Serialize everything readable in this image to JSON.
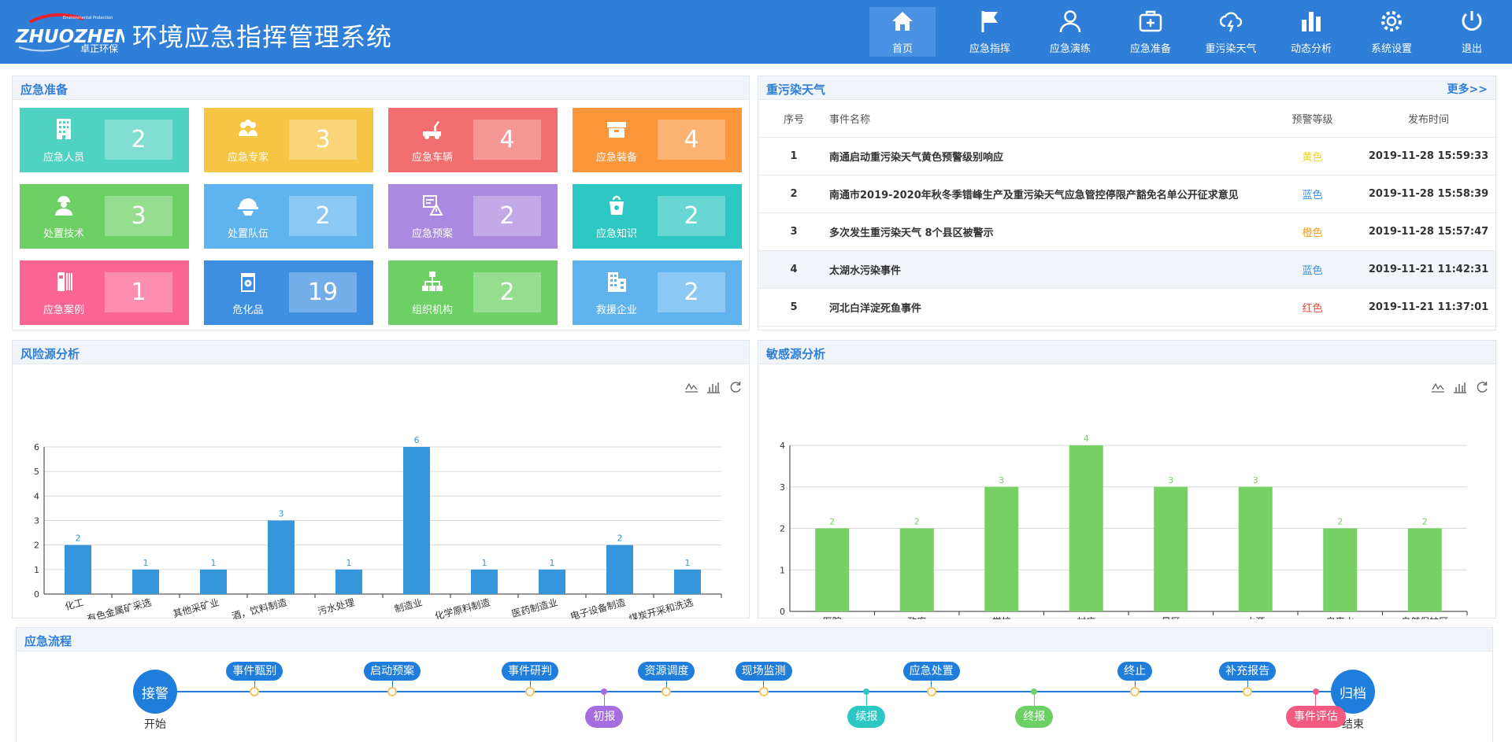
{
  "header": {
    "brand_en": "ZHUOZHENG",
    "brand_tag": "Environmental Protection",
    "brand_cn": "卓正环保",
    "title": "环境应急指挥管理系统",
    "nav": [
      {
        "label": "首页",
        "icon": "home-icon",
        "active": true
      },
      {
        "label": "应急指挥",
        "icon": "flag-icon"
      },
      {
        "label": "应急演练",
        "icon": "user-icon"
      },
      {
        "label": "应急准备",
        "icon": "medkit-icon"
      },
      {
        "label": "重污染天气",
        "icon": "storm-cloud-icon"
      },
      {
        "label": "动态分析",
        "icon": "bar-chart-icon"
      },
      {
        "label": "系统设置",
        "icon": "gear-icon"
      },
      {
        "label": "退出",
        "icon": "power-icon"
      }
    ]
  },
  "prep": {
    "title": "应急准备",
    "tiles": [
      {
        "label": "应急人员",
        "count": "2",
        "color": "#4fd2c1",
        "icon": "building-icon"
      },
      {
        "label": "应急专家",
        "count": "3",
        "color": "#f7c544",
        "icon": "experts-icon"
      },
      {
        "label": "应急车辆",
        "count": "4",
        "color": "#f36f6f",
        "icon": "tow-truck-icon"
      },
      {
        "label": "应急装备",
        "count": "4",
        "color": "#fb963b",
        "icon": "equipment-box-icon"
      },
      {
        "label": "处置技术",
        "count": "3",
        "color": "#6cd065",
        "icon": "worker-icon"
      },
      {
        "label": "处置队伍",
        "count": "2",
        "color": "#5fb3ef",
        "icon": "helmet-icon"
      },
      {
        "label": "应急预案",
        "count": "2",
        "color": "#ab89e0",
        "icon": "plan-doc-icon"
      },
      {
        "label": "应急知识",
        "count": "2",
        "color": "#2ec8c4",
        "icon": "knowledge-bag-icon"
      },
      {
        "label": "应急案例",
        "count": "1",
        "color": "#fb6593",
        "icon": "case-file-icon"
      },
      {
        "label": "危化品",
        "count": "19",
        "color": "#3e8fe2",
        "icon": "hazmat-barrel-icon"
      },
      {
        "label": "组织机构",
        "count": "2",
        "color": "#6cd065",
        "icon": "org-chart-icon"
      },
      {
        "label": "救援企业",
        "count": "2",
        "color": "#5fb3ef",
        "icon": "enterprise-icon"
      }
    ]
  },
  "weather": {
    "title": "重污染天气",
    "more": "更多>>",
    "columns": [
      "序号",
      "事件名称",
      "预警等级",
      "发布时间"
    ],
    "rows": [
      {
        "idx": "1",
        "name": "南通启动重污染天气黄色预警级别响应",
        "level": "黄色",
        "level_color": "#f5d21a",
        "time": "2019-11-28 15:59:33"
      },
      {
        "idx": "2",
        "name": "南通市2019-2020年秋冬季错峰生产及重污染天气应急管控停限产豁免名单公开征求意见",
        "level": "蓝色",
        "level_color": "#3b8fe3",
        "time": "2019-11-28 15:58:39"
      },
      {
        "idx": "3",
        "name": "多次发生重污染天气 8个县区被警示",
        "level": "橙色",
        "level_color": "#f39c12",
        "time": "2019-11-28 15:57:47"
      },
      {
        "idx": "4",
        "name": "太湖水污染事件",
        "level": "蓝色",
        "level_color": "#3b8fe3",
        "time": "2019-11-21 11:42:31"
      },
      {
        "idx": "5",
        "name": "河北白洋淀死鱼事件",
        "level": "红色",
        "level_color": "#e74c3c",
        "time": "2019-11-21 11:37:01"
      }
    ]
  },
  "risk": {
    "title": "风险源分析",
    "chart_data": {
      "type": "bar",
      "categories": [
        "化工",
        "有色金属矿采选",
        "其他采矿业",
        "酒，饮料制造",
        "污水处理",
        "制造业",
        "化学原料制造",
        "医药制造业",
        "电子设备制造",
        "煤炭开采和洗选"
      ],
      "values": [
        2,
        1,
        1,
        3,
        1,
        6,
        1,
        1,
        2,
        1
      ],
      "ylim": [
        0,
        6
      ],
      "yticks": [
        0,
        1,
        2,
        3,
        4,
        5,
        6
      ],
      "color": "#3596dc",
      "grid": true
    }
  },
  "sensitive": {
    "title": "敏感源分析",
    "chart_data": {
      "type": "bar",
      "categories": [
        "医院",
        "政府",
        "学校",
        "村庄",
        "景区",
        "水源",
        "自来水",
        "自然保护区"
      ],
      "values": [
        2,
        2,
        3,
        4,
        3,
        3,
        2,
        2
      ],
      "ylim": [
        0,
        4
      ],
      "yticks": [
        0,
        1,
        2,
        3,
        4
      ],
      "color": "#77d064",
      "grid": true
    }
  },
  "flow": {
    "title": "应急流程",
    "start": {
      "label": "接警",
      "caption": "开始"
    },
    "end": {
      "label": "归档",
      "caption": "结束"
    },
    "top_steps": [
      {
        "label": "事件甄别",
        "pos": 0.083
      },
      {
        "label": "启动预案",
        "pos": 0.198
      },
      {
        "label": "事件研判",
        "pos": 0.313
      },
      {
        "label": "资源调度",
        "pos": 0.427
      },
      {
        "label": "现场监测",
        "pos": 0.508
      },
      {
        "label": "应急处置",
        "pos": 0.648
      },
      {
        "label": "终止",
        "pos": 0.818
      },
      {
        "label": "补充报告",
        "pos": 0.912
      }
    ],
    "bottom_steps": [
      {
        "label": "初报",
        "color": "#a56de0",
        "pos": 0.375
      },
      {
        "label": "续报",
        "color": "#2ec8c4",
        "pos": 0.594
      },
      {
        "label": "终报",
        "color": "#6cd065",
        "pos": 0.734
      },
      {
        "label": "事件评估",
        "color": "#f35a7f",
        "pos": 0.969
      }
    ],
    "line_color": "#1f7ddb",
    "step_color": "#1f7ddb",
    "marker_color": "#f5c35b"
  }
}
